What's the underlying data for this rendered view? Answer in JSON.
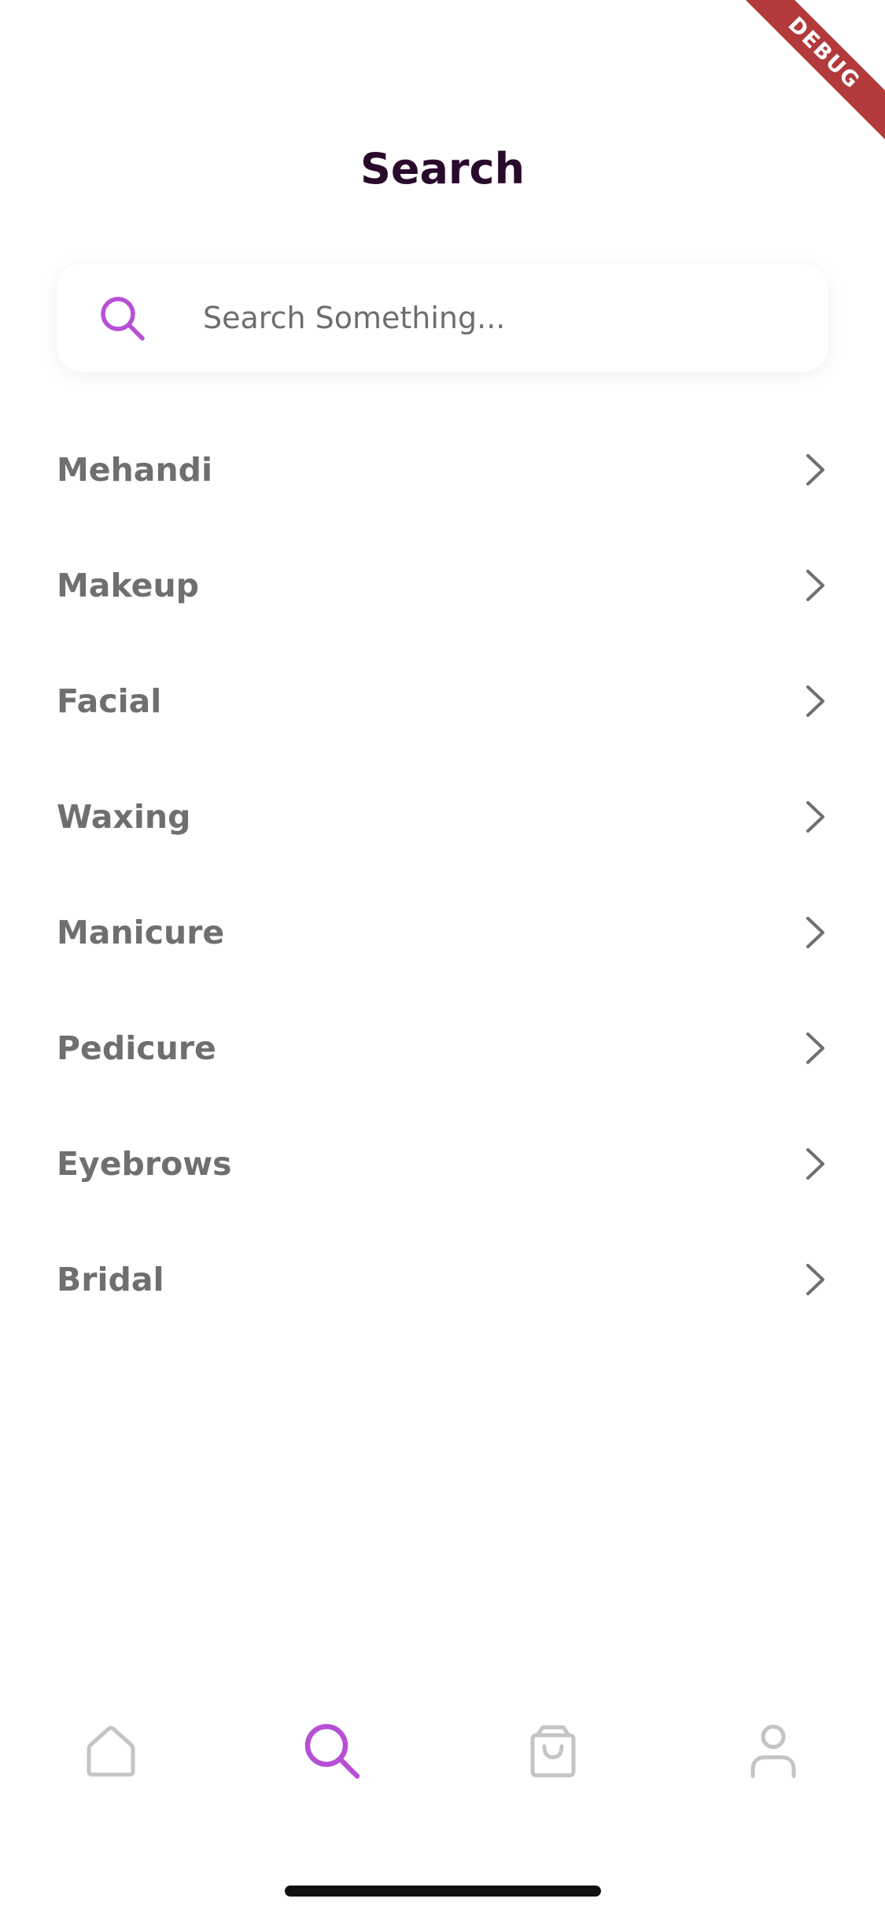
{
  "debug_banner": {
    "label": "DEBUG",
    "color": "#b23a3a"
  },
  "header": {
    "title": "Search"
  },
  "search": {
    "placeholder": "Search Something...",
    "value": "",
    "icon": "search-icon",
    "accent_color": "#b64fd6"
  },
  "categories": [
    {
      "label": "Mehandi"
    },
    {
      "label": "Makeup"
    },
    {
      "label": "Facial"
    },
    {
      "label": "Waxing"
    },
    {
      "label": "Manicure"
    },
    {
      "label": "Pedicure"
    },
    {
      "label": "Eyebrows"
    },
    {
      "label": "Bridal"
    }
  ],
  "bottom_nav": {
    "active": "search",
    "items": [
      {
        "id": "home",
        "icon": "home-icon"
      },
      {
        "id": "search",
        "icon": "search-icon"
      },
      {
        "id": "cart",
        "icon": "shopping-bag-icon"
      },
      {
        "id": "profile",
        "icon": "user-icon"
      }
    ],
    "active_color": "#b64fd6",
    "inactive_color": "#c4c4c4"
  }
}
